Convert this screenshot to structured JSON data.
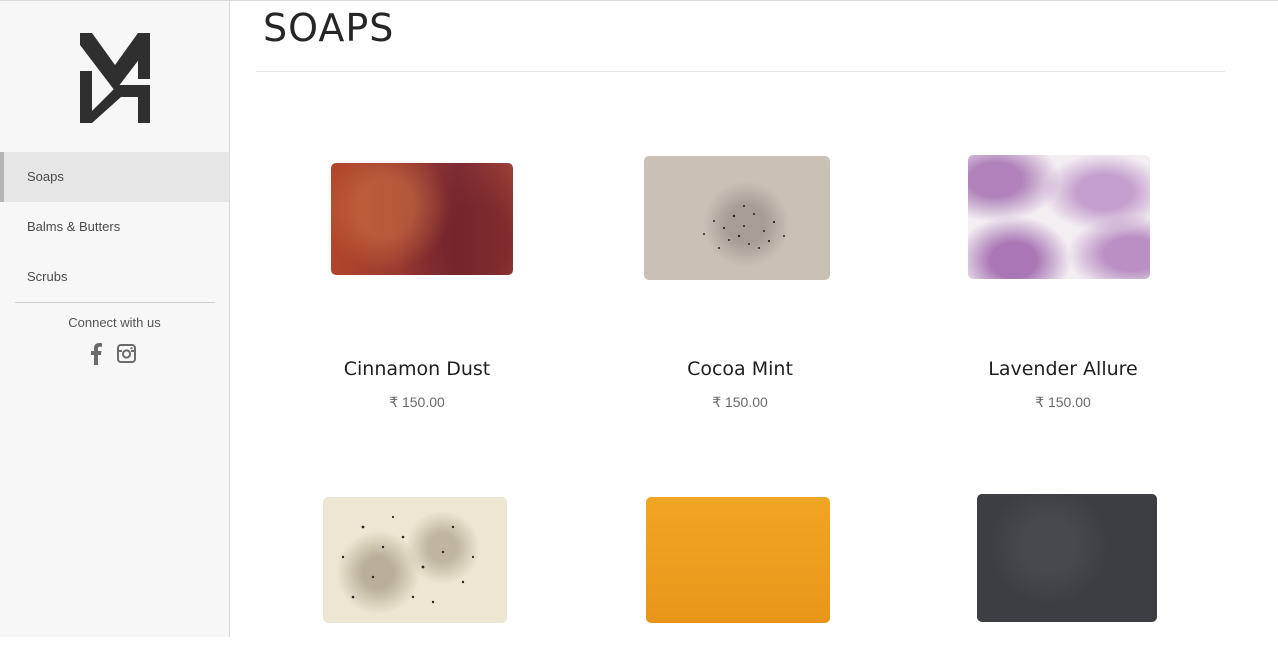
{
  "sidebar": {
    "logo_name": "monogram-logo",
    "nav": [
      {
        "label": "Soaps",
        "active": true
      },
      {
        "label": "Balms & Butters",
        "active": false
      },
      {
        "label": "Scrubs",
        "active": false
      }
    ],
    "connect_label": "Connect with us",
    "social_icons": [
      "facebook-icon",
      "instagram-icon"
    ]
  },
  "main": {
    "title": "SOAPS",
    "products": [
      {
        "name": "Cinnamon Dust",
        "price": "₹ 150.00",
        "color": "#9a3a30"
      },
      {
        "name": "Cocoa Mint",
        "price": "₹ 150.00",
        "color": "#c9c1b6"
      },
      {
        "name": "Lavender Allure",
        "price": "₹ 150.00",
        "color": "#f3eef2"
      },
      {
        "name": "",
        "price": "",
        "color": "#ece6d2"
      },
      {
        "name": "",
        "price": "",
        "color": "#f1a623"
      },
      {
        "name": "",
        "price": "",
        "color": "#3d3e42"
      }
    ]
  }
}
